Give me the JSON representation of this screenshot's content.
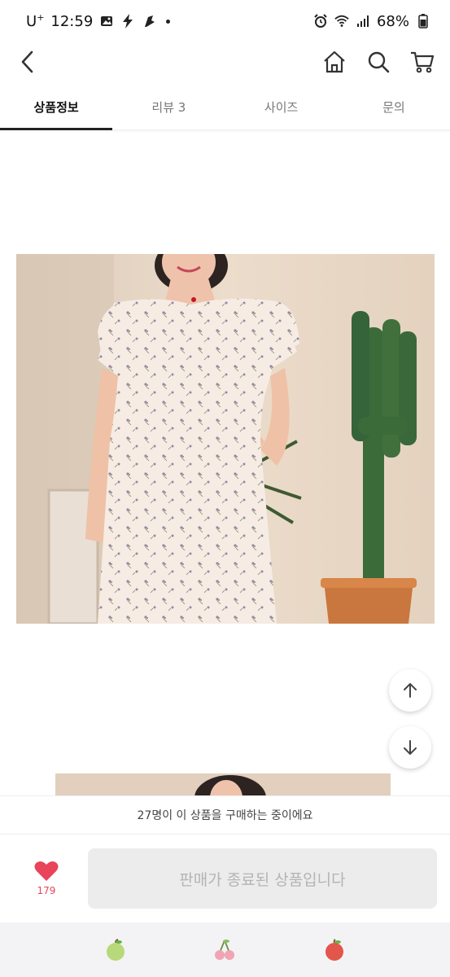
{
  "status_bar": {
    "carrier": "U",
    "carrier_sup": "+",
    "time": "12:59",
    "battery": "68%"
  },
  "nav": {
    "icons": [
      "back-icon",
      "home-icon",
      "search-icon",
      "cart-icon"
    ]
  },
  "tabs": [
    {
      "label": "상품정보",
      "active": true
    },
    {
      "label": "리뷰 3",
      "active": false
    },
    {
      "label": "사이즈",
      "active": false
    },
    {
      "label": "문의",
      "active": false
    }
  ],
  "notice": "27명이 이 상품을 구매하는 중이에요",
  "like": {
    "count": "179",
    "color": "#e8445a"
  },
  "buy_button": "판매가 종료된 상품입니다",
  "fruits": [
    "apple-icon",
    "cherry-icon",
    "peach-icon"
  ]
}
